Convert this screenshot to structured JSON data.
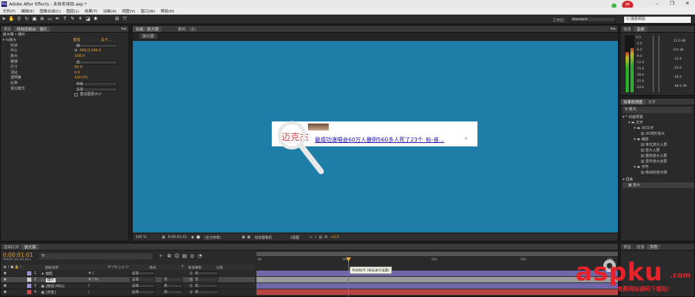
{
  "window": {
    "app_icon": "Ae",
    "title": "Adobe After Effects - 未命名项目.aep *"
  },
  "menu": [
    "文件(F)",
    "编辑(E)",
    "图像合成(C)",
    "图层(L)",
    "效果(T)",
    "动画(A)",
    "视图(V)",
    "窗口(W)",
    "帮助(H)"
  ],
  "toolbar": {
    "workspace_label": "工作区：",
    "workspace_value": "Standard",
    "help_search_placeholder": "搜索帮助",
    "badge_count": "86",
    "badge_label": "点我加速"
  },
  "effect_controls": {
    "tabs": [
      "项目",
      "特效控制台：镜片"
    ],
    "context": "放大镜 • 镜片",
    "effect_name": "放大",
    "reset": "重置",
    "about": "关于...",
    "props": [
      {
        "name": "形状",
        "value": "圆",
        "type": "dropdown"
      },
      {
        "name": "中心",
        "value": "346.0,346.0",
        "type": "point"
      },
      {
        "name": "放大",
        "value": "158.0",
        "type": "number"
      },
      {
        "name": "链接",
        "value": "无",
        "type": "dropdown"
      },
      {
        "name": "尺寸",
        "value": "50.0",
        "type": "number"
      },
      {
        "name": "羽化",
        "value": "0.0",
        "type": "number"
      },
      {
        "name": "透明度",
        "value": "100.0%",
        "type": "number"
      },
      {
        "name": "比例",
        "value": "标准",
        "type": "dropdown"
      },
      {
        "name": "混合模式",
        "value": "正常",
        "type": "dropdown"
      }
    ],
    "checkbox_label": "重设图层大小"
  },
  "composition": {
    "tabs": [
      "合成：放大镜",
      "素材：(无)"
    ],
    "breadcrumb": "放大镜",
    "ad_left": "迈克杰",
    "ad_link": "最成功演唱会60万人暴倒560多人死了23个_标-音...",
    "ad_sub": "...",
    "footer": {
      "zoom": "100 %",
      "timecode": "0:00:01:01",
      "resolution": "(全分辨率)",
      "camera": "有效摄像机",
      "views": "1视图",
      "exposure": "+0.0"
    }
  },
  "info_panel": {
    "tabs": [
      "信息",
      "音频"
    ],
    "scale_left": [
      "0.0",
      "-3.0",
      "-6.0",
      "-9.0",
      "-12.0",
      "-15.0",
      "-18.0",
      "-21.0",
      "-24.0"
    ],
    "scale_right": [
      "12.0 dB",
      "0.0 dB",
      "-12.0",
      "-24.0",
      "-36.0",
      "-48.0 dB"
    ]
  },
  "effects_presets": {
    "tabs": [
      "效果和预置",
      "文字"
    ],
    "search_value": "放大",
    "tree": [
      {
        "label": "* 动画预置",
        "level": 0
      },
      {
        "label": "文字",
        "level": 1
      },
      {
        "label": "3D文字",
        "level": 2
      },
      {
        "label": "3D球形放大",
        "level": 3
      },
      {
        "label": "缩放",
        "level": 2
      },
      {
        "label": "单位放大入屏",
        "level": 3
      },
      {
        "label": "放大入屏",
        "level": 3
      },
      {
        "label": "整体放大入屏",
        "level": 3
      },
      {
        "label": "逐字放大出屏",
        "level": 3
      },
      {
        "label": "字符",
        "level": 2
      },
      {
        "label": "移动的放大镜",
        "level": 3
      },
      {
        "label": "扭曲",
        "level": 0
      },
      {
        "label": "放大",
        "level": 1
      }
    ]
  },
  "timeline": {
    "tabs": [
      "渲染队列",
      "放大镜"
    ],
    "timecode": "0:00:01:01",
    "frame_info": "00026 (25.00 fps)",
    "columns": [
      "图层名称",
      "模式",
      "T",
      "轨道蒙板",
      "父级"
    ],
    "layers": [
      {
        "index": "1",
        "name": "镜框",
        "mode": "正常",
        "track": "",
        "parent": "无",
        "color": "#9a93d8"
      },
      {
        "index": "2",
        "name": "镜片",
        "mode": "正常",
        "track": "无",
        "parent": "无",
        "color": "#cfcfcf"
      },
      {
        "index": "3",
        "name": "[俯视.PNG]",
        "mode": "正常",
        "track": "无",
        "parent": "无",
        "color": "#9a93d8"
      },
      {
        "index": "4",
        "name": "[背景]",
        "mode": "正常",
        "track": "无",
        "parent": "无",
        "color": "#d04a4a"
      }
    ],
    "ruler": [
      "0s",
      "01s",
      "02s",
      "03s",
      "04s"
    ],
    "tooltip": "时间标尺 (单击进行设置)"
  },
  "bottom_right": {
    "tabs": [
      "预览",
      "段落",
      "字符"
    ]
  },
  "watermark": {
    "brand": "aspku",
    "tld": ".com",
    "slogan": "免费网站源码下载站！"
  },
  "colors": {
    "viewer_bg": "#1e7ea8",
    "accent": "#e8a63a",
    "watermark_red": "#e8222a"
  }
}
